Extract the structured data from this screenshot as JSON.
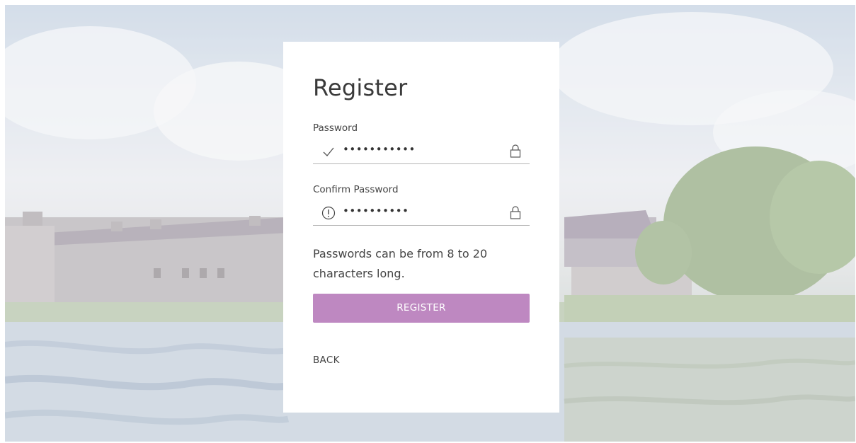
{
  "form": {
    "title": "Register",
    "password": {
      "label": "Password",
      "masked_value": "•••••••••••",
      "status_icon": "check-icon",
      "trailing_icon": "lock-icon"
    },
    "confirm_password": {
      "label": "Confirm Password",
      "masked_value": "••••••••••",
      "status_icon": "exclamation-circle-icon",
      "trailing_icon": "lock-icon"
    },
    "hint": "Passwords can be from 8 to 20 characters long.",
    "register_label": "REGISTER",
    "back_label": "BACK"
  },
  "colors": {
    "accent": "#be88c1",
    "card_bg": "#ffffff",
    "text": "#444444"
  }
}
